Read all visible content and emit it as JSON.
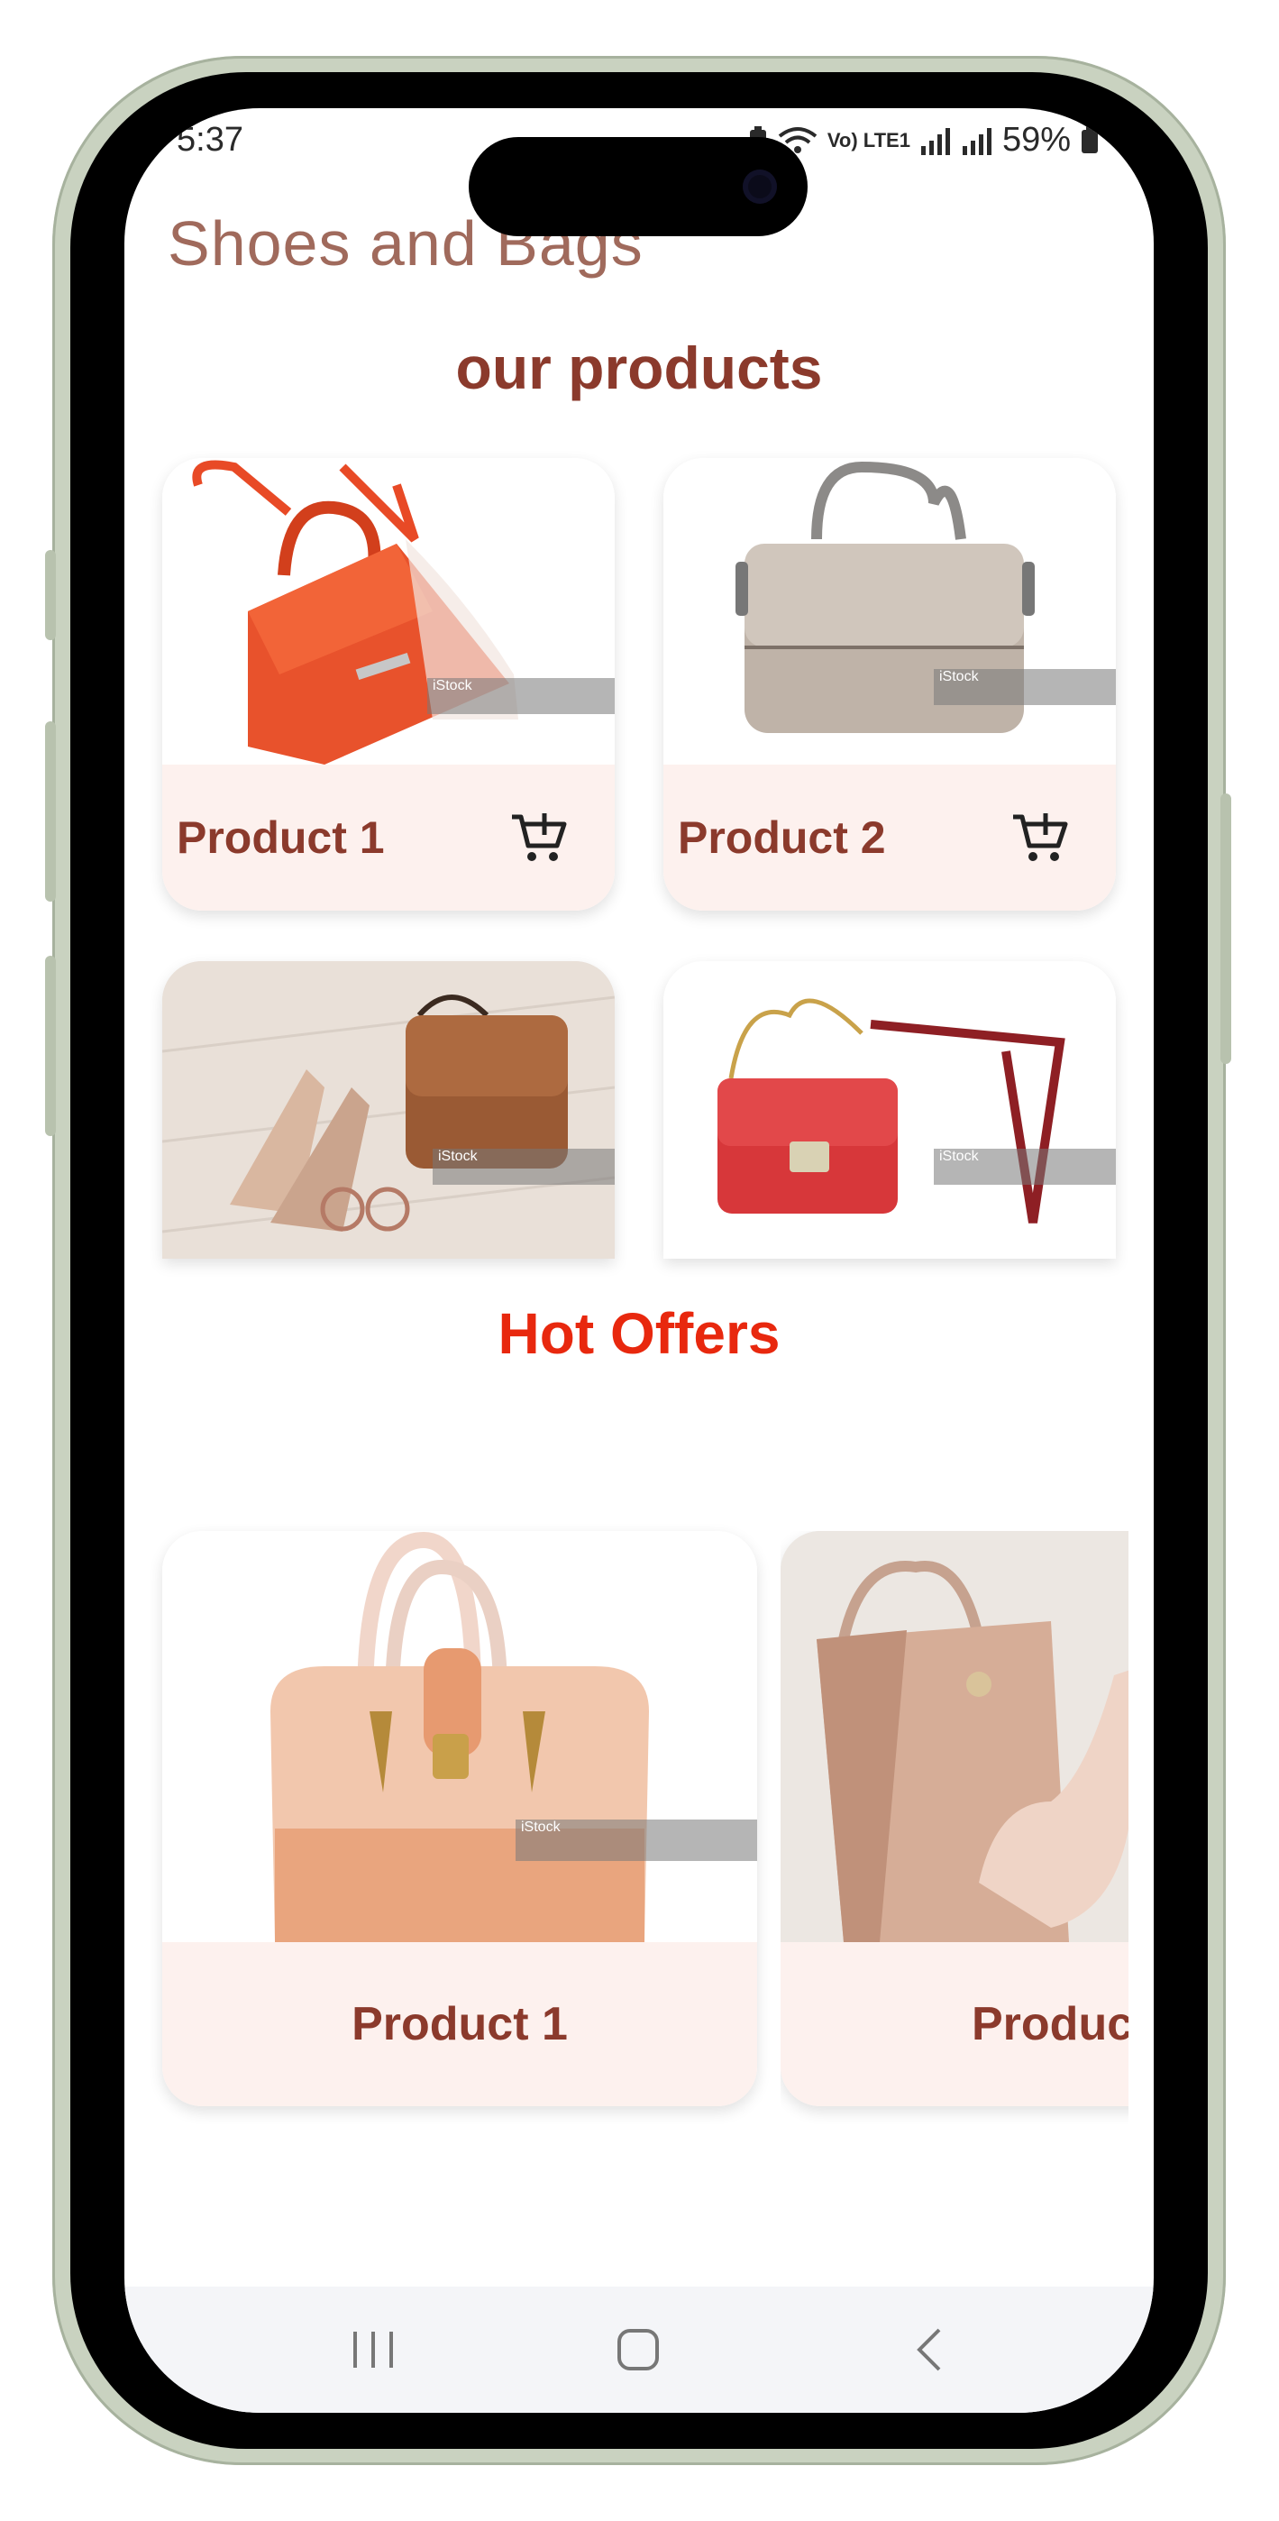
{
  "status": {
    "time": "5:37",
    "network": "Vo) LTE1",
    "battery": "59%"
  },
  "app": {
    "title": "Shoes and Bags"
  },
  "our_products": {
    "title": "our products",
    "items": [
      {
        "label": "Product 1",
        "image": "orange-handbag"
      },
      {
        "label": "Product 2",
        "image": "silver-handbag"
      },
      {
        "label": "",
        "image": "shoes-and-brown-bag"
      },
      {
        "label": "",
        "image": "red-crossbody-bag"
      }
    ]
  },
  "hot_offers": {
    "title": "Hot Offers",
    "items": [
      {
        "label": "Product 1",
        "image": "peach-croc-handbag"
      },
      {
        "label": "Produc",
        "image": "nude-patent-bag-and-heels"
      }
    ]
  },
  "watermark": "iStock",
  "colors": {
    "title": "#8b3a2c",
    "hot": "#e8280e",
    "card_footer": "#fdf1ee"
  }
}
